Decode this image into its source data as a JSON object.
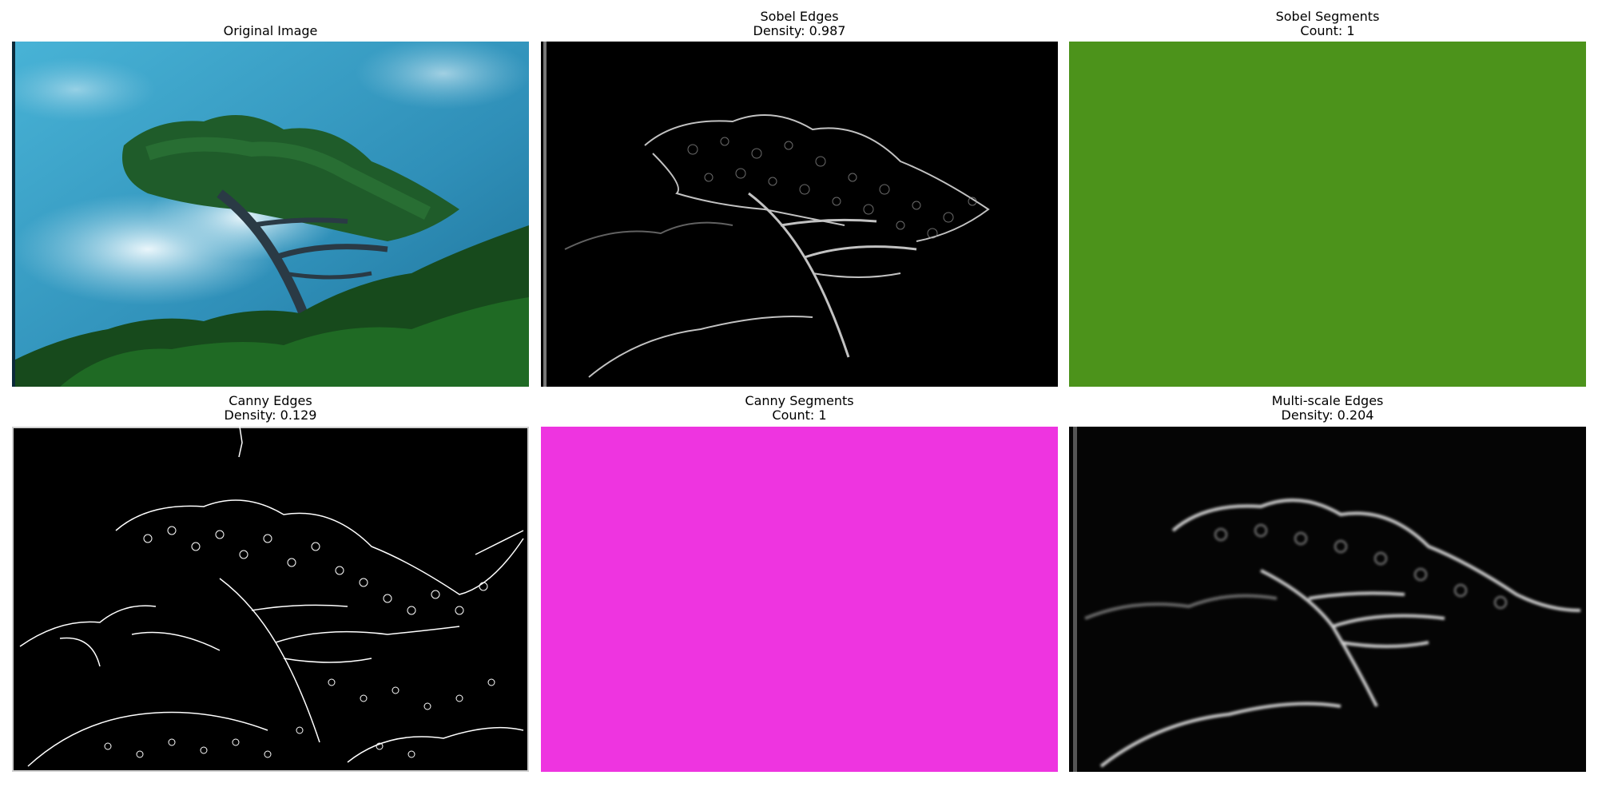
{
  "panels": [
    {
      "title": "Original Image",
      "subtitle": ""
    },
    {
      "title": "Sobel Edges",
      "subtitle": "Density: 0.987"
    },
    {
      "title": "Sobel Segments",
      "subtitle": "Count: 1"
    },
    {
      "title": "Canny Edges",
      "subtitle": "Density: 0.129"
    },
    {
      "title": "Canny Segments",
      "subtitle": "Count: 1"
    },
    {
      "title": "Multi-scale Edges",
      "subtitle": "Density: 0.204"
    }
  ],
  "colors": {
    "sobel_segments_fill": "#4c931b",
    "canny_segments_fill": "#ee34e0",
    "edge_background": "#000000",
    "sky": "#3aa6c8",
    "foliage": "#1d5e22"
  }
}
